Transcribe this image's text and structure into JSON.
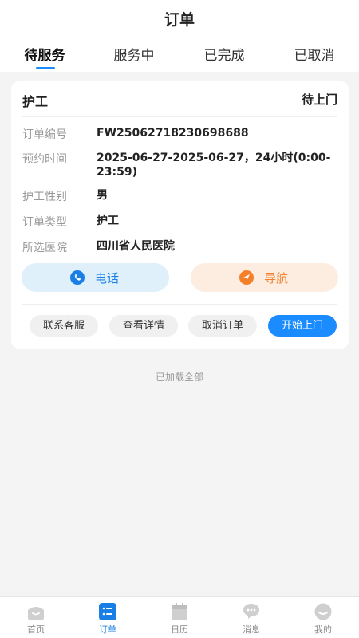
{
  "header": {
    "title": "订单"
  },
  "tabs": [
    {
      "label": "待服务",
      "active": true
    },
    {
      "label": "服务中",
      "active": false
    },
    {
      "label": "已完成",
      "active": false
    },
    {
      "label": "已取消",
      "active": false
    }
  ],
  "order": {
    "type": "护工",
    "status": "待上门",
    "fields": [
      {
        "label": "订单编号",
        "value": "FW25062718230698688"
      },
      {
        "label": "预约时间",
        "value": "2025-06-27-2025-06-27，24小时(0:00-23:59)"
      },
      {
        "label": "护工性别",
        "value": "男"
      },
      {
        "label": "订单类型",
        "value": "护工"
      },
      {
        "label": "所选医院",
        "value": "四川省人民医院"
      }
    ],
    "call_label": "电话",
    "navigate_label": "导航",
    "actions": [
      "联系客服",
      "查看详情",
      "取消订单",
      "开始上门"
    ]
  },
  "list_footer": "已加载全部",
  "bottom_nav": [
    {
      "label": "首页",
      "icon": "home-icon",
      "active": false
    },
    {
      "label": "订单",
      "icon": "order-list-icon",
      "active": true
    },
    {
      "label": "日历",
      "icon": "calendar-icon",
      "active": false
    },
    {
      "label": "消息",
      "icon": "message-icon",
      "active": false
    },
    {
      "label": "我的",
      "icon": "profile-icon",
      "active": false
    }
  ],
  "colors": {
    "accent": "#1a8cff",
    "call": "#1a7fe5",
    "navigate": "#f5802a",
    "background": "#f4f4f4"
  }
}
